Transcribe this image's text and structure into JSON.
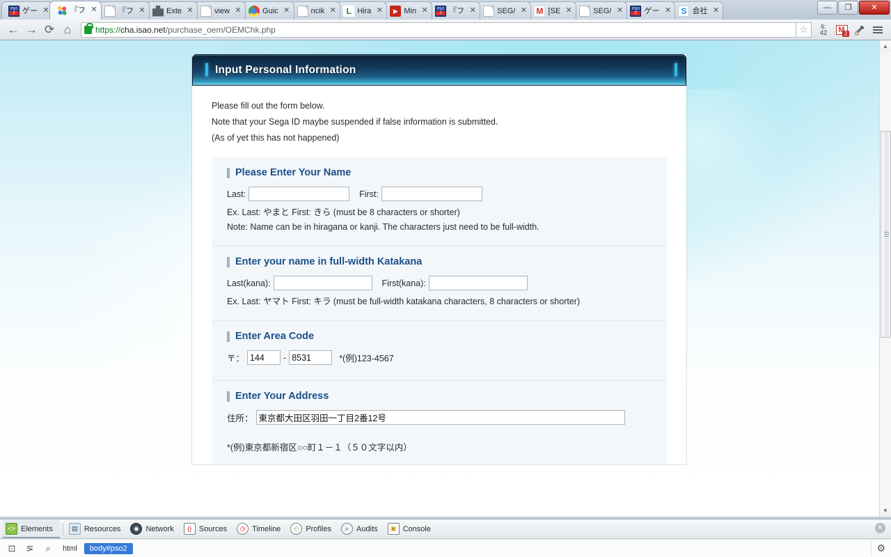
{
  "browser": {
    "tabs": [
      {
        "title": "ゲー",
        "icon": "pso2-icon",
        "active": false
      },
      {
        "title": "『フ",
        "icon": "colorful-icon",
        "active": true
      },
      {
        "title": "『フ",
        "icon": "document-icon",
        "active": false
      },
      {
        "title": "Exte",
        "icon": "puzzle-icon",
        "active": false
      },
      {
        "title": "view",
        "icon": "document-icon",
        "active": false
      },
      {
        "title": "Guic",
        "icon": "chrome-icon",
        "active": false
      },
      {
        "title": "ncik",
        "icon": "document-icon",
        "active": false
      },
      {
        "title": "Hira",
        "icon": "letter-l-icon",
        "active": false
      },
      {
        "title": "Min",
        "icon": "video-icon",
        "active": false
      },
      {
        "title": "『フ",
        "icon": "pso2-icon",
        "active": false
      },
      {
        "title": "SEG/",
        "icon": "document-icon",
        "active": false
      },
      {
        "title": "[SE",
        "icon": "gmail-icon",
        "active": false
      },
      {
        "title": "SEG/",
        "icon": "document-icon",
        "active": false
      },
      {
        "title": "ゲー",
        "icon": "pso2-icon",
        "active": false
      },
      {
        "title": "会社",
        "icon": "letter-s-icon",
        "active": false
      }
    ],
    "tab_close_label": "✕",
    "window_controls": {
      "minimize": "—",
      "maximize": "❐",
      "close": "✕"
    },
    "toolbar": {
      "back": "←",
      "forward": "→",
      "reload": "⟳",
      "home": "⌂",
      "url_scheme": "https://",
      "url_host": "cha.isao.net",
      "url_rest": "/purchase_oem/OEMChk.php",
      "bookmark_star": "☆",
      "clock_ext_top": "6:",
      "clock_ext_bottom": "42",
      "gmail_ext_letter": "M",
      "gmail_ext_badge": "2",
      "eyedropper": "⚗",
      "menu": "menu-icon"
    }
  },
  "page": {
    "header_title": "Input Personal Information",
    "bracket_left": "❙",
    "bracket_right": "❙",
    "intro": [
      "Please fill out the form below.",
      "Note that your Sega ID maybe suspended if false information is submitted.",
      "(As of yet this has not happened)"
    ],
    "sections": [
      {
        "title": "Please Enter Your Name",
        "last_label": "Last:",
        "last_value": "",
        "first_label": "First:",
        "first_value": "",
        "hint1": "Ex. Last: やまと First: きら (must be 8 characters or shorter)",
        "hint2": "Note: Name can be in hiragana or kanji. The characters just need to be full-width."
      },
      {
        "title": "Enter your name in full-width Katakana",
        "last_label": "Last(kana):",
        "last_value": "",
        "first_label": "First(kana):",
        "first_value": "",
        "hint1": "Ex. Last: ヤマト First: キラ (must be full-width katakana characters, 8 characters or shorter)"
      },
      {
        "title": "Enter Area Code",
        "zip_label": "〒：",
        "zip1_value": "144",
        "zip_dash": "-",
        "zip2_value": "8531",
        "zip_example": "*(例)123-4567"
      },
      {
        "title": "Enter Your Address",
        "addr_label": "住所：",
        "addr_value": "東京都大田区羽田一丁目2番12号",
        "addr_hint": "*(例)東京都新宿区○○町１－１（５０文字以内）"
      }
    ]
  },
  "devtools": {
    "tabs": [
      {
        "label": "Elements",
        "icon": "elements-icon",
        "glyph": "<>",
        "active": true
      },
      {
        "label": "Resources",
        "icon": "resources-icon",
        "glyph": "▤",
        "active": false
      },
      {
        "label": "Network",
        "icon": "network-icon",
        "glyph": "◉",
        "active": false
      },
      {
        "label": "Sources",
        "icon": "sources-icon",
        "glyph": "{}",
        "active": false
      },
      {
        "label": "Timeline",
        "icon": "timeline-icon",
        "glyph": "◷",
        "active": false
      },
      {
        "label": "Profiles",
        "icon": "profiles-icon",
        "glyph": "◴",
        "active": false
      },
      {
        "label": "Audits",
        "icon": "audits-icon",
        "glyph": "⌕",
        "active": false
      },
      {
        "label": "Console",
        "icon": "console-icon",
        "glyph": "▣",
        "active": false
      }
    ],
    "dock_icon": "⊡",
    "indent_icon": "⋝",
    "search_icon": "⌕",
    "breadcrumbs": [
      {
        "label": "html",
        "selected": false
      },
      {
        "label": "body#pso2",
        "selected": true
      }
    ],
    "close_label": "✕",
    "gear_label": "⚙"
  },
  "colors": {
    "accent_blue": "#1c4f8a",
    "header_dark": "#0c2338",
    "header_cyan": "#7fdcf0",
    "crumb_selected": "#3879d9"
  }
}
